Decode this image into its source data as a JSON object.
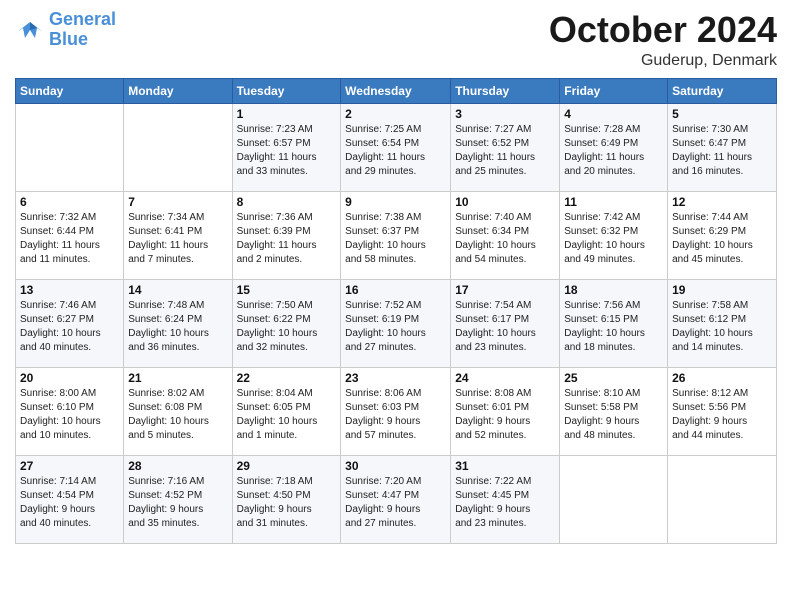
{
  "header": {
    "logo_line1": "General",
    "logo_line2": "Blue",
    "month_title": "October 2024",
    "location": "Guderup, Denmark"
  },
  "weekdays": [
    "Sunday",
    "Monday",
    "Tuesday",
    "Wednesday",
    "Thursday",
    "Friday",
    "Saturday"
  ],
  "weeks": [
    [
      {
        "day": "",
        "info": ""
      },
      {
        "day": "",
        "info": ""
      },
      {
        "day": "1",
        "info": "Sunrise: 7:23 AM\nSunset: 6:57 PM\nDaylight: 11 hours\nand 33 minutes."
      },
      {
        "day": "2",
        "info": "Sunrise: 7:25 AM\nSunset: 6:54 PM\nDaylight: 11 hours\nand 29 minutes."
      },
      {
        "day": "3",
        "info": "Sunrise: 7:27 AM\nSunset: 6:52 PM\nDaylight: 11 hours\nand 25 minutes."
      },
      {
        "day": "4",
        "info": "Sunrise: 7:28 AM\nSunset: 6:49 PM\nDaylight: 11 hours\nand 20 minutes."
      },
      {
        "day": "5",
        "info": "Sunrise: 7:30 AM\nSunset: 6:47 PM\nDaylight: 11 hours\nand 16 minutes."
      }
    ],
    [
      {
        "day": "6",
        "info": "Sunrise: 7:32 AM\nSunset: 6:44 PM\nDaylight: 11 hours\nand 11 minutes."
      },
      {
        "day": "7",
        "info": "Sunrise: 7:34 AM\nSunset: 6:41 PM\nDaylight: 11 hours\nand 7 minutes."
      },
      {
        "day": "8",
        "info": "Sunrise: 7:36 AM\nSunset: 6:39 PM\nDaylight: 11 hours\nand 2 minutes."
      },
      {
        "day": "9",
        "info": "Sunrise: 7:38 AM\nSunset: 6:37 PM\nDaylight: 10 hours\nand 58 minutes."
      },
      {
        "day": "10",
        "info": "Sunrise: 7:40 AM\nSunset: 6:34 PM\nDaylight: 10 hours\nand 54 minutes."
      },
      {
        "day": "11",
        "info": "Sunrise: 7:42 AM\nSunset: 6:32 PM\nDaylight: 10 hours\nand 49 minutes."
      },
      {
        "day": "12",
        "info": "Sunrise: 7:44 AM\nSunset: 6:29 PM\nDaylight: 10 hours\nand 45 minutes."
      }
    ],
    [
      {
        "day": "13",
        "info": "Sunrise: 7:46 AM\nSunset: 6:27 PM\nDaylight: 10 hours\nand 40 minutes."
      },
      {
        "day": "14",
        "info": "Sunrise: 7:48 AM\nSunset: 6:24 PM\nDaylight: 10 hours\nand 36 minutes."
      },
      {
        "day": "15",
        "info": "Sunrise: 7:50 AM\nSunset: 6:22 PM\nDaylight: 10 hours\nand 32 minutes."
      },
      {
        "day": "16",
        "info": "Sunrise: 7:52 AM\nSunset: 6:19 PM\nDaylight: 10 hours\nand 27 minutes."
      },
      {
        "day": "17",
        "info": "Sunrise: 7:54 AM\nSunset: 6:17 PM\nDaylight: 10 hours\nand 23 minutes."
      },
      {
        "day": "18",
        "info": "Sunrise: 7:56 AM\nSunset: 6:15 PM\nDaylight: 10 hours\nand 18 minutes."
      },
      {
        "day": "19",
        "info": "Sunrise: 7:58 AM\nSunset: 6:12 PM\nDaylight: 10 hours\nand 14 minutes."
      }
    ],
    [
      {
        "day": "20",
        "info": "Sunrise: 8:00 AM\nSunset: 6:10 PM\nDaylight: 10 hours\nand 10 minutes."
      },
      {
        "day": "21",
        "info": "Sunrise: 8:02 AM\nSunset: 6:08 PM\nDaylight: 10 hours\nand 5 minutes."
      },
      {
        "day": "22",
        "info": "Sunrise: 8:04 AM\nSunset: 6:05 PM\nDaylight: 10 hours\nand 1 minute."
      },
      {
        "day": "23",
        "info": "Sunrise: 8:06 AM\nSunset: 6:03 PM\nDaylight: 9 hours\nand 57 minutes."
      },
      {
        "day": "24",
        "info": "Sunrise: 8:08 AM\nSunset: 6:01 PM\nDaylight: 9 hours\nand 52 minutes."
      },
      {
        "day": "25",
        "info": "Sunrise: 8:10 AM\nSunset: 5:58 PM\nDaylight: 9 hours\nand 48 minutes."
      },
      {
        "day": "26",
        "info": "Sunrise: 8:12 AM\nSunset: 5:56 PM\nDaylight: 9 hours\nand 44 minutes."
      }
    ],
    [
      {
        "day": "27",
        "info": "Sunrise: 7:14 AM\nSunset: 4:54 PM\nDaylight: 9 hours\nand 40 minutes."
      },
      {
        "day": "28",
        "info": "Sunrise: 7:16 AM\nSunset: 4:52 PM\nDaylight: 9 hours\nand 35 minutes."
      },
      {
        "day": "29",
        "info": "Sunrise: 7:18 AM\nSunset: 4:50 PM\nDaylight: 9 hours\nand 31 minutes."
      },
      {
        "day": "30",
        "info": "Sunrise: 7:20 AM\nSunset: 4:47 PM\nDaylight: 9 hours\nand 27 minutes."
      },
      {
        "day": "31",
        "info": "Sunrise: 7:22 AM\nSunset: 4:45 PM\nDaylight: 9 hours\nand 23 minutes."
      },
      {
        "day": "",
        "info": ""
      },
      {
        "day": "",
        "info": ""
      }
    ]
  ]
}
